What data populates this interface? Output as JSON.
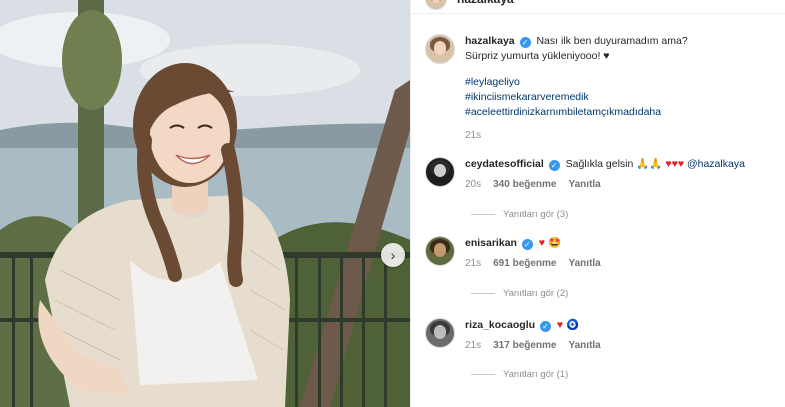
{
  "post": {
    "author": "hazalkaya",
    "top_author_text": "hazalkaya"
  },
  "caption": {
    "username": "hazalkaya",
    "line1": "Nası ilk ben duyuramadım ama?",
    "line2": "Sürpriz yumurta yükleniyooo! ♥",
    "hashtags": [
      "#leylageliyo",
      "#ikinciismekararveremedik",
      "#aceleettirdinizkarnımbiletamçıkmadıdaha"
    ],
    "time": "21s"
  },
  "comments": [
    {
      "username": "ceydatesofficial",
      "text": "Sağlıkla gelsin 🙏🙏",
      "hearts": "♥♥♥",
      "mention": "@hazalkaya",
      "time": "20s",
      "likes": "340 beğenme",
      "reply_label": "Yanıtla",
      "view_replies": "Yanıtları gör (3)"
    },
    {
      "username": "enisarikan",
      "text": "♥",
      "emoji2": "🤩",
      "time": "21s",
      "likes": "691 beğenme",
      "reply_label": "Yanıtla",
      "view_replies": "Yanıtları gör (2)"
    },
    {
      "username": "riza_kocaoglu",
      "text": "♥",
      "emoji2": "🧿",
      "time": "21s",
      "likes": "317 beğenme",
      "reply_label": "Yanıtla",
      "view_replies": "Yanıtları gör (1)"
    }
  ],
  "icons": {
    "verified": "verified-badge-icon",
    "carousel": "chevron-right-icon"
  },
  "colors": {
    "verified": "#3897f0",
    "heart": "#ed1c24",
    "link": "#00376b",
    "muted": "#8e8e8e"
  },
  "glyphs": {
    "check": "✓",
    "chevron": "›"
  }
}
